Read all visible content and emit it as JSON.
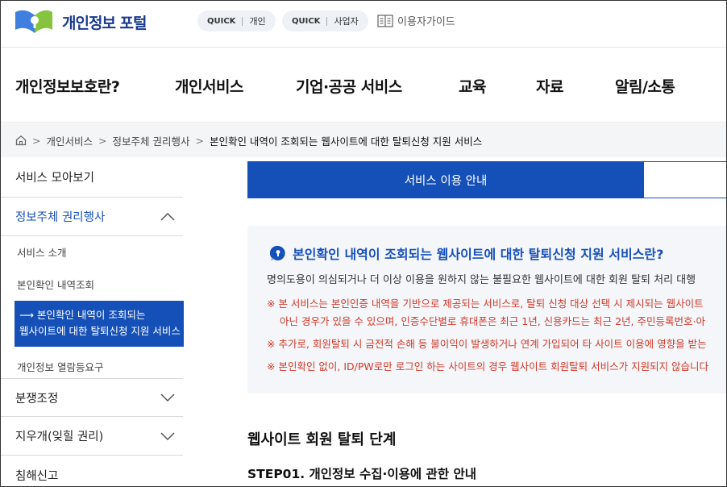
{
  "header": {
    "logo_text": "개인정보 포털",
    "quick1": {
      "tag": "QUICK",
      "label": "개인"
    },
    "quick2": {
      "tag": "QUICK",
      "label": "사업자"
    },
    "guide_label": "이용자가이드"
  },
  "gnb": {
    "items": [
      {
        "label": "개인정보보호란?"
      },
      {
        "label": "개인서비스"
      },
      {
        "label": "기업·공공 서비스"
      },
      {
        "label": "교육"
      },
      {
        "label": "자료"
      },
      {
        "label": "알림/소통"
      }
    ]
  },
  "breadcrumb": {
    "items": [
      "개인서비스",
      "정보주체 권리행사"
    ],
    "current": "본인확인 내역이 조회되는 웹사이트에 대한 탈퇴신청 지원 서비스"
  },
  "side": {
    "item_collect": "서비스 모아보기",
    "item_rights": "정보주체 권리행사",
    "sub_intro": "서비스 소개",
    "sub_history": "본인확인 내역조회",
    "sub_active_line1": "본인확인 내역이 조회되는",
    "sub_active_line2": "웹사이트에 대한 탈퇴신청 지원 서비스",
    "sub_view": "개인정보 열람등요구",
    "item_dispute": "분쟁조정",
    "item_erase": "지우개(잊힐 권리)",
    "item_report": "침해신고"
  },
  "tabs": {
    "active": "서비스 이용 안내"
  },
  "info": {
    "title": "본인확인 내역이 조회되는 웹사이트에 대한 탈퇴신청 지원 서비스란?",
    "desc": "명의도용이 의심되거나 더 이상 이용을 원하지 않는 불필요한 웹사이트에 대한 회원 탈퇴 처리 대행",
    "note1_a": "※ 본 서비스는 본인인증 내역을 기반으로 제공되는 서비스로, 탈퇴 신청 대상 선택 시 제시되는 웹사이트",
    "note1_b": "아닌 경우가 있을 수 있으며, 인증수단별로 휴대폰은 최근 1년, 신용카드는 최근 2년, 주민등록번호·아",
    "note2": "※ 추가로, 회원탈퇴 시 금전적 손해 등 불이익이 발생하거나 연계 가입되어 타 사이트 이용에 영향을 받는",
    "note3": "※ 본인확인 없이, ID/PW로만 로그인 하는 사이트의 경우 웹사이트 회원탈퇴 서비스가 지원되지 않습니다"
  },
  "section": {
    "title": "웹사이트 회원 탈퇴 단계",
    "step1": "STEP01. 개인정보 수집·이용에 관한 안내"
  },
  "colors": {
    "primary": "#1550b8",
    "highlight": "#d7f27a",
    "warning": "#d23a2a"
  }
}
